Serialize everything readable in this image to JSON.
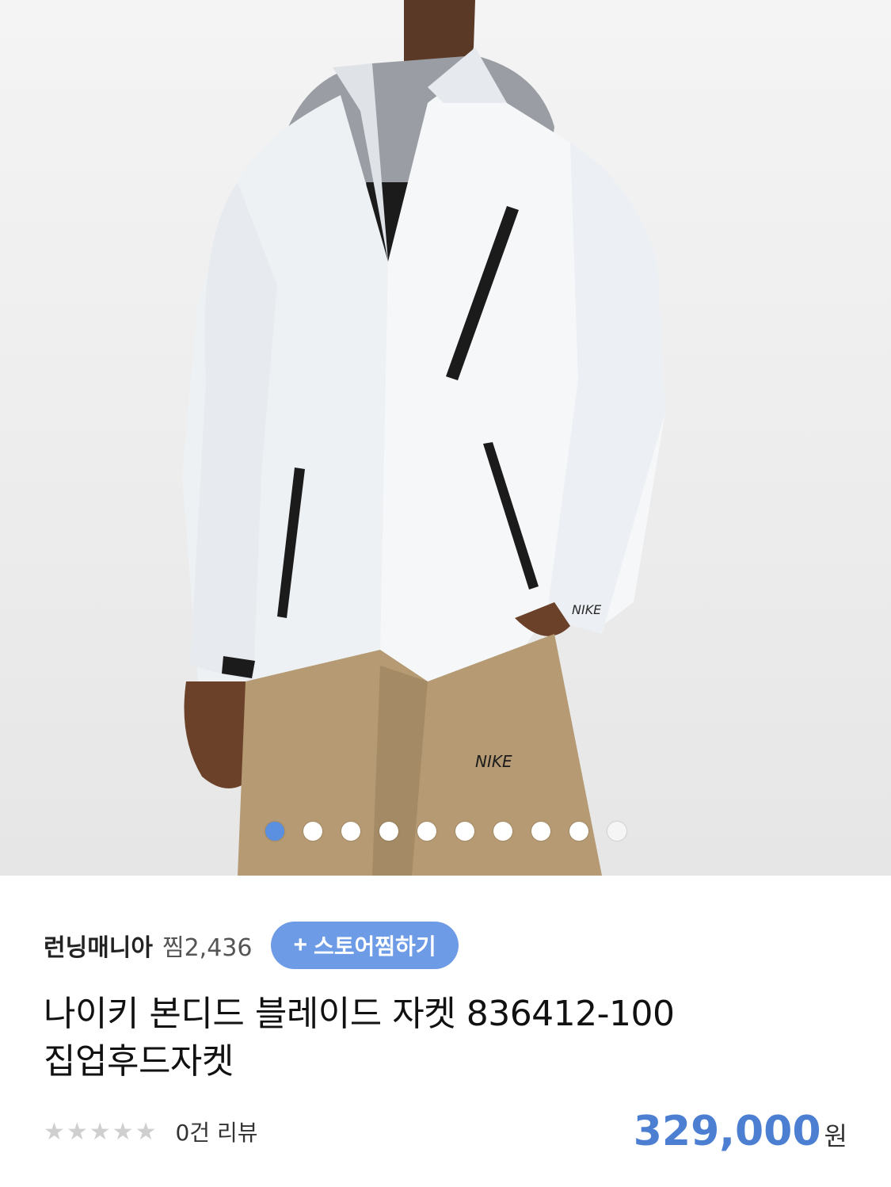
{
  "product": {
    "image_alt": "white hooded jacket on model",
    "carousel_total": 10,
    "carousel_active_index": 0,
    "sleeve_logo": "NIKE",
    "pants_logo": "NIKE"
  },
  "store": {
    "name": "런닝매니아",
    "likes": "찜2,436",
    "follow_plus": "+",
    "follow_label": "스토어찜하기"
  },
  "title_line1": "나이키 본디드 블레이드 자켓 836412-100",
  "title_line2": "집업후드자켓",
  "rating": {
    "stars": "★★★★★",
    "reviews": "0건 리뷰"
  },
  "price": {
    "amount": "329,000",
    "unit": "원"
  },
  "colors": {
    "accent": "#6d9be6",
    "price": "#4c7fd2",
    "dot_active": "#5b8fe0"
  }
}
